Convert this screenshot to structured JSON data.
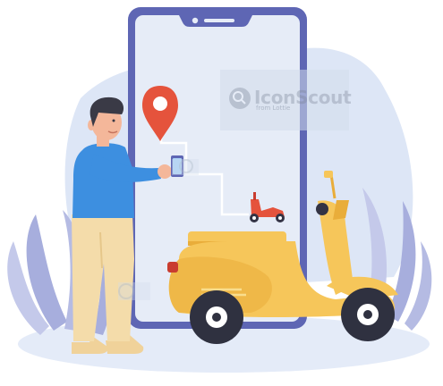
{
  "watermark": {
    "brand": "IconScout",
    "sub": "from Lottie"
  },
  "colors": {
    "phone_frame": "#5e66b4",
    "phone_screen": "#e6ecf7",
    "background_blob": "#dde6f6",
    "leaves": "#a7aedd",
    "leaves_light": "#c4c9ea",
    "pin": "#e5533c",
    "scooter_body": "#f6c65a",
    "scooter_shade": "#e9ad3a",
    "scooter_accent": "#c93c2f",
    "shirt": "#3d8fe0",
    "pants": "#f4dcaa",
    "skin": "#f4b79a",
    "hair": "#3a3a46",
    "shoes": "#f0d29a",
    "ground": "#e4ebf8"
  },
  "icons": [
    "location-pin-icon",
    "mini-scooter-icon",
    "smartphone-icon",
    "watermark-logo-icon"
  ]
}
